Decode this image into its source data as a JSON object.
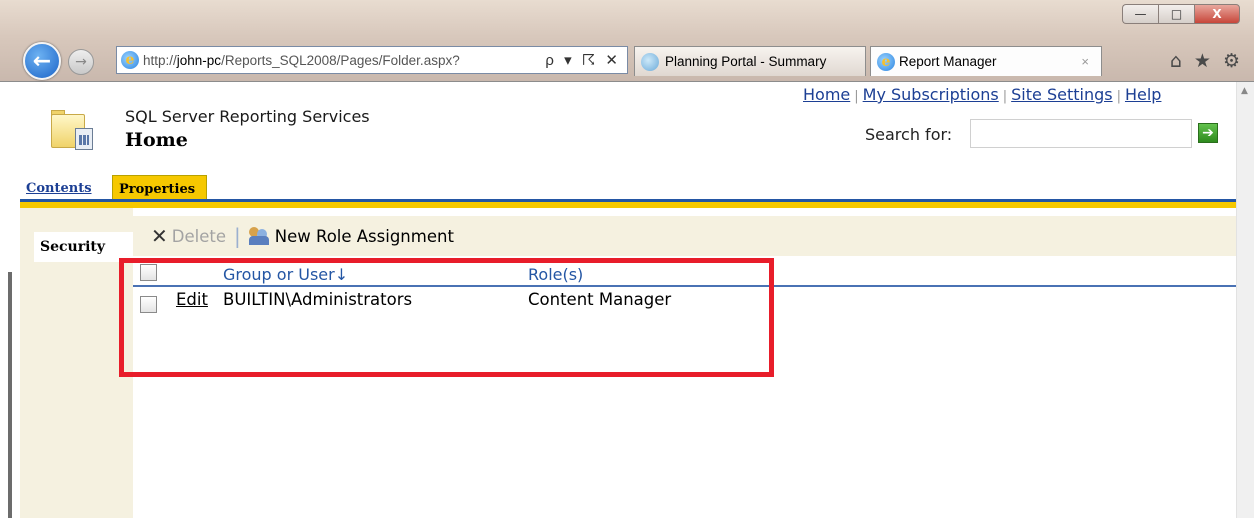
{
  "browser": {
    "window_buttons": [
      "—",
      "□",
      "X"
    ],
    "address": {
      "prefix": "http://",
      "host": "john-pc",
      "path": "/Reports_SQL2008/Pages/Folder.aspx?",
      "tools": "ρ ▾ ☈ ✕"
    },
    "tabs": [
      {
        "title": "Planning Portal - Summary"
      },
      {
        "title": "Report Manager",
        "close": "×"
      }
    ],
    "right_tools": {
      "home": "⌂",
      "star": "★",
      "gear": "⚙"
    }
  },
  "page": {
    "app_title": "SQL Server Reporting Services",
    "title": "Home",
    "top_links": [
      "Home",
      "My Subscriptions",
      "Site Settings",
      "Help"
    ],
    "link_separator": "|",
    "search": {
      "label": "Search for:",
      "value": "",
      "go": "➔"
    },
    "tabs": {
      "contents": "Contents",
      "properties": "Properties"
    },
    "left_nav": {
      "security": "Security"
    },
    "toolbar": {
      "delete_icon": "✕",
      "delete": "Delete",
      "separator": "|",
      "new_role": "New Role Assignment"
    },
    "grid": {
      "headers": {
        "group": "Group or User↓",
        "role": "Role(s)"
      },
      "rows": [
        {
          "action": "Edit",
          "user": "BUILTIN\\Administrators",
          "role": "Content Manager"
        }
      ]
    }
  },
  "colors": {
    "tab_active": "#f6c800",
    "accent_blue": "#2456a4",
    "highlight_red": "#e81d2a",
    "nav_bg": "#f5f1e0"
  }
}
